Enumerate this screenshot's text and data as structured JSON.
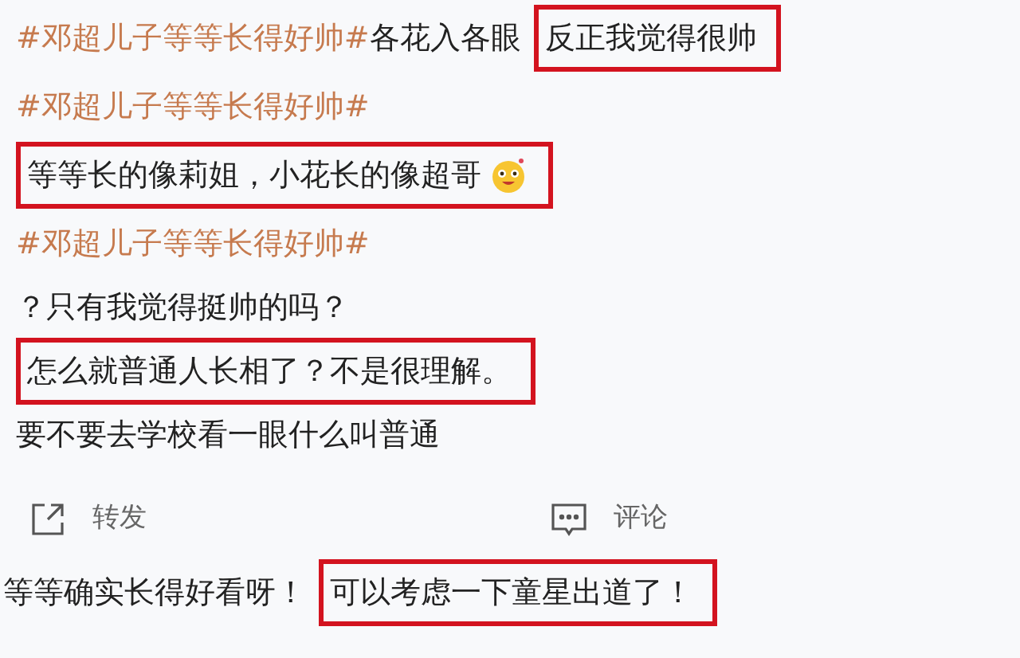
{
  "lines": [
    {
      "segments": [
        {
          "kind": "hashtag",
          "text": "#邓超儿子等等长得好帅#"
        },
        {
          "kind": "text",
          "text": "各花入各眼"
        },
        {
          "kind": "boxed",
          "text": "反正我觉得很帅"
        }
      ]
    },
    {
      "segments": [
        {
          "kind": "hashtag",
          "text": "#邓超儿子等等长得好帅#"
        }
      ]
    },
    {
      "segments": [
        {
          "kind": "boxed",
          "text": "等等长的像莉姐，小花长的像超哥",
          "emoji": true
        }
      ]
    },
    {
      "segments": [
        {
          "kind": "hashtag",
          "text": "#邓超儿子等等长得好帅#"
        }
      ]
    },
    {
      "segments": [
        {
          "kind": "text",
          "text": "？只有我觉得挺帅的吗？"
        }
      ]
    },
    {
      "segments": [
        {
          "kind": "boxed",
          "text": "怎么就普通人长相了？不是很理解。"
        }
      ]
    },
    {
      "segments": [
        {
          "kind": "text",
          "text": "要不要去学校看一眼什么叫普通"
        }
      ]
    }
  ],
  "actions": [
    {
      "kind": "share",
      "label": "转发"
    },
    {
      "kind": "comment",
      "label": "评论"
    }
  ],
  "footer": {
    "segments": [
      {
        "kind": "text",
        "text": "等等确实长得好看呀！"
      },
      {
        "kind": "boxed",
        "text": "可以考虑一下童星出道了！"
      }
    ]
  }
}
